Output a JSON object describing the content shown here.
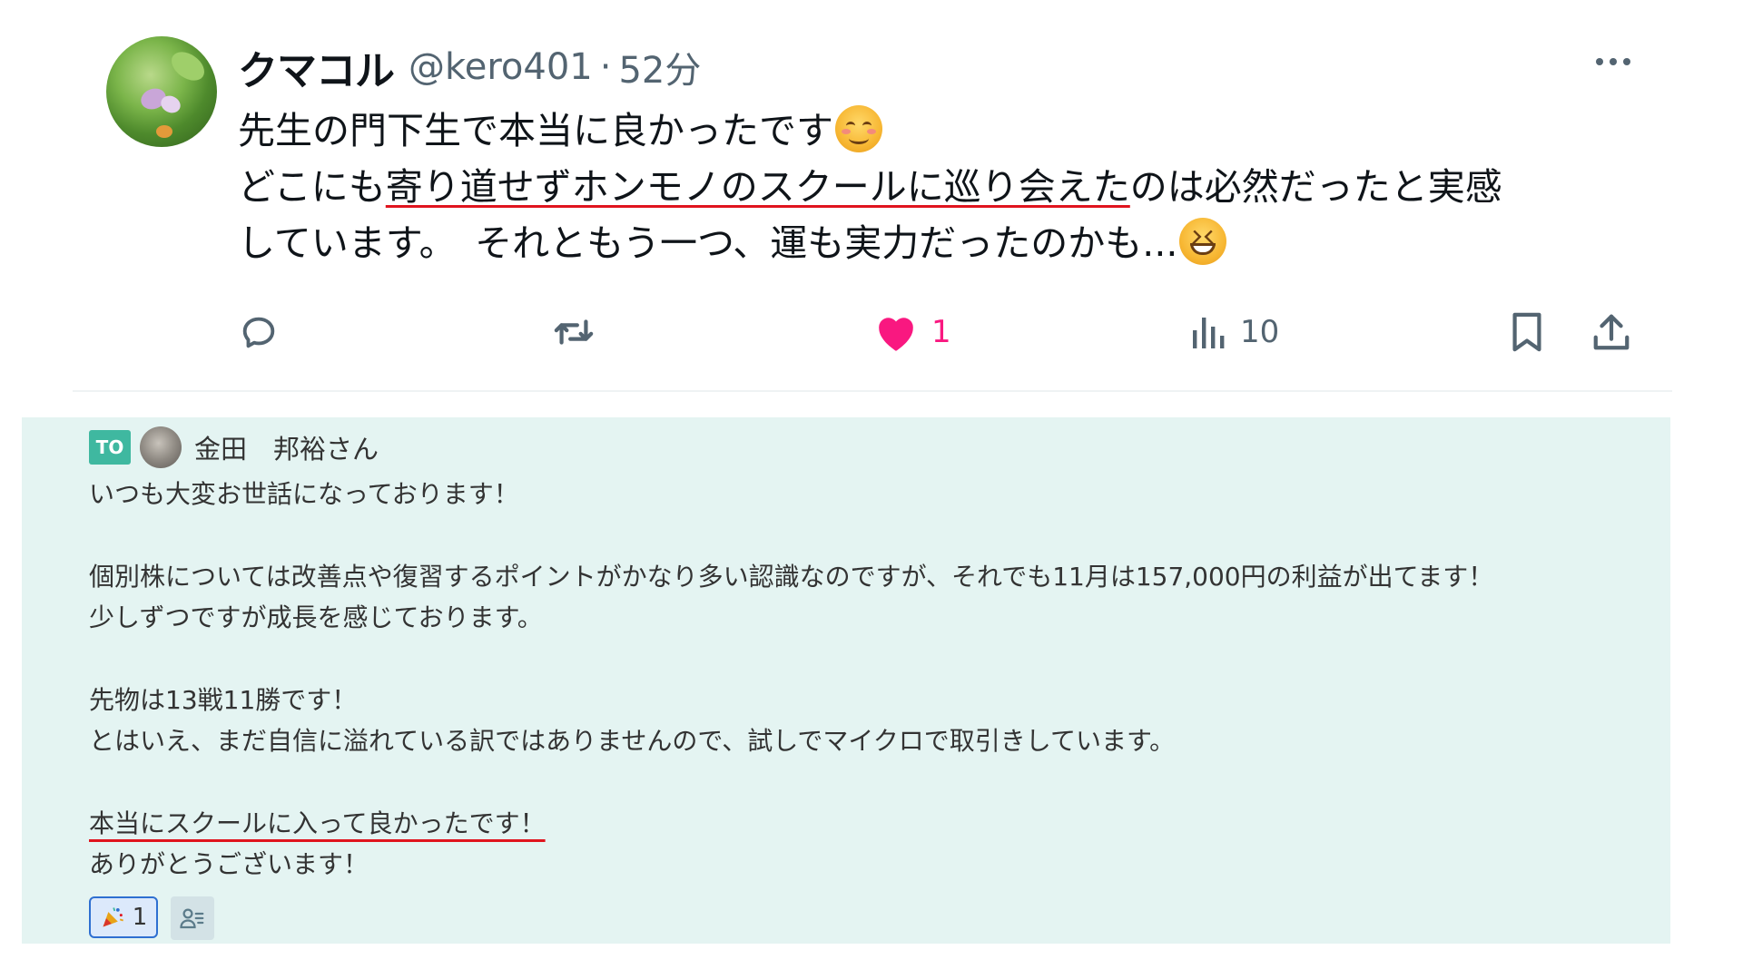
{
  "tweet": {
    "display_name": "クマコル",
    "handle": "@kero401",
    "separator": "·",
    "timestamp": "52分",
    "lines": [
      {
        "segments": [
          {
            "text": "先生の門下生で本当に良かったです"
          }
        ],
        "emoji": "smiling-face-emoji"
      },
      {
        "segments": [
          {
            "text": "どこにも"
          },
          {
            "text": "寄り道せずホンモノのスクールに巡り会えた",
            "underline": true
          },
          {
            "text": "のは必然だったと実感"
          }
        ]
      },
      {
        "segments": [
          {
            "text": "しています。　それともう一つ、運も実力だったのかも..."
          }
        ],
        "emoji": "grinning-squinting-face-emoji"
      }
    ],
    "actions": {
      "reply_count": "",
      "retweet_count": "",
      "like_count": "1",
      "views_count": "10"
    },
    "colors": {
      "like": "#f91880",
      "muted": "#536471",
      "underline": "#e0141e"
    }
  },
  "chat": {
    "to_badge": "TO",
    "sender": "金田　邦裕さん",
    "lines": [
      "いつも大変お世話になっております！",
      "",
      "個別株については改善点や復習するポイントがかなり多い認識なのですが、それでも11月は157,000円の利益が出てます！",
      "少しずつですが成長を感じております。",
      "",
      "先物は13戦11勝です！",
      "とはいえ、まだ自信に溢れている訳ではありませんので、試しでマイクロで取引きしています。",
      "",
      "本当にスクールに入って良かったです！",
      "ありがとうございます！"
    ],
    "underlined_line_index": 8,
    "reaction": {
      "icon": "party-popper-icon",
      "count": "1"
    },
    "colors": {
      "background": "#e4f4f2",
      "badge": "#3fb8a0",
      "reaction_border": "#2e6fd1"
    }
  }
}
